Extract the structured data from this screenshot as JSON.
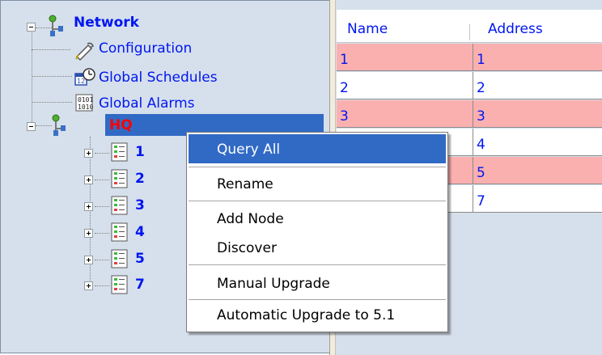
{
  "tree": {
    "root_label": "Network",
    "children": [
      {
        "label": "Configuration",
        "icon": "configuration-icon"
      },
      {
        "label": "Global Schedules",
        "icon": "calendar-clock-icon"
      },
      {
        "label": "Global Alarms",
        "icon": "binary-alarm-icon"
      }
    ],
    "site_label": "HQ",
    "nodes": [
      "1",
      "2",
      "3",
      "4",
      "5",
      "7"
    ]
  },
  "table": {
    "columns": [
      "Name",
      "Address"
    ],
    "rows": [
      {
        "name": "1",
        "address": "1",
        "highlight": true
      },
      {
        "name": "2",
        "address": "2",
        "highlight": false
      },
      {
        "name": "3",
        "address": "3",
        "highlight": true
      },
      {
        "name": "",
        "address": "4",
        "highlight": false
      },
      {
        "name": "",
        "address": "5",
        "highlight": true
      },
      {
        "name": "",
        "address": "7",
        "highlight": false
      }
    ],
    "highlight_color": "#fbb0b0",
    "normal_color": "#ffffff"
  },
  "context_menu": {
    "items": [
      {
        "label": "Query All",
        "selected": true
      },
      {
        "label": "Rename",
        "selected": false
      },
      {
        "label": "Add Node",
        "selected": false
      },
      {
        "label": "Discover",
        "selected": false
      },
      {
        "label": "Manual Upgrade",
        "selected": false
      },
      {
        "label": "Automatic Upgrade to 5.1",
        "selected": false
      }
    ]
  },
  "colors": {
    "link_blue": "#0016f0",
    "selection_blue": "#316ac5",
    "hq_red": "#ff0000",
    "panel_bg": "#d6e0ec"
  }
}
